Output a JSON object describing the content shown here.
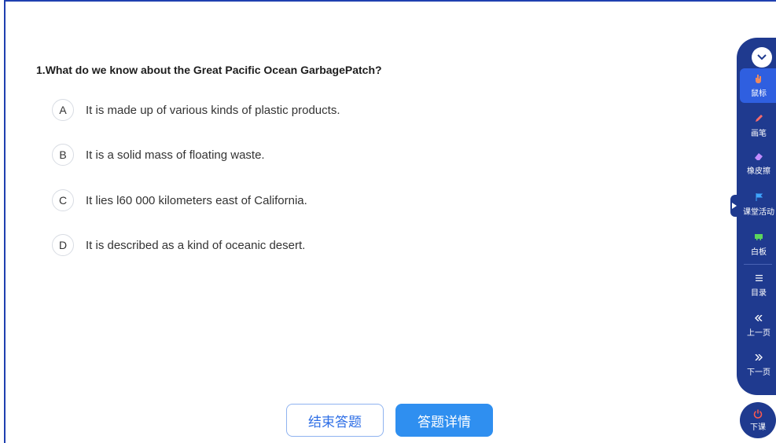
{
  "question": {
    "number": "1.",
    "text": "What do we know about the Great Pacific Ocean GarbagePatch?"
  },
  "options": [
    {
      "letter": "A",
      "text": "It is made up of various kinds of plastic products."
    },
    {
      "letter": "B",
      "text": "It is a solid mass of floating waste."
    },
    {
      "letter": "C",
      "text": "It lies l60 000 kilometers east of California."
    },
    {
      "letter": "D",
      "text": "It is described as a kind of oceanic desert."
    }
  ],
  "buttons": {
    "end_answer": "结束答题",
    "answer_details": "答题详情"
  },
  "toolbar": {
    "items": [
      {
        "label": "鼠标",
        "icon": "mouse-hand-icon"
      },
      {
        "label": "画笔",
        "icon": "pen-icon"
      },
      {
        "label": "橡皮擦",
        "icon": "eraser-icon"
      },
      {
        "label": "课堂活动",
        "icon": "flag-icon"
      },
      {
        "label": "白板",
        "icon": "whiteboard-icon"
      },
      {
        "label": "目录",
        "icon": "list-icon"
      },
      {
        "label": "上一页",
        "icon": "double-left-icon"
      },
      {
        "label": "下一页",
        "icon": "double-right-icon"
      }
    ],
    "end_class": "下课"
  },
  "colors": {
    "toolbar_bg": "#1f3a8f",
    "active_tool": "#2f5fe0",
    "primary_button": "#2f8ff0",
    "frame_border": "#1f3fb0"
  }
}
